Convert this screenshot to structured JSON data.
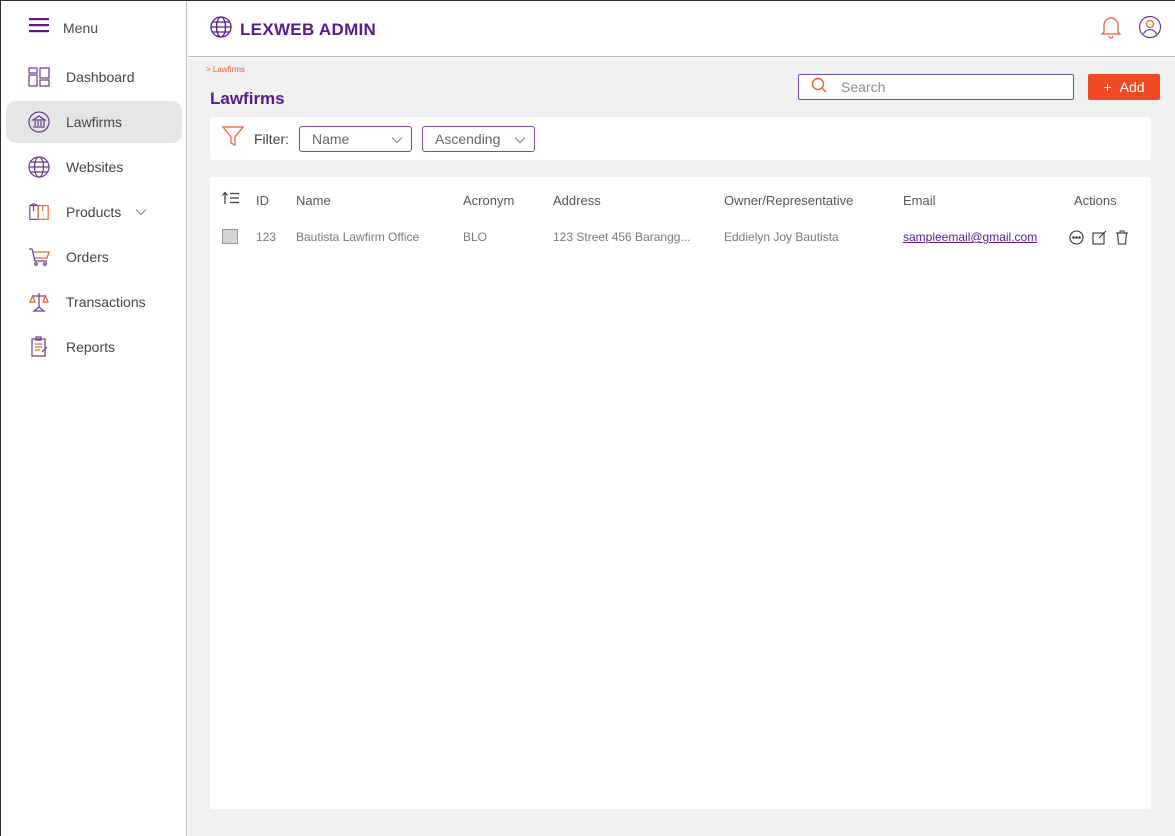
{
  "app": {
    "title": "LEXWEB ADMIN"
  },
  "sidebar": {
    "menu_label": "Menu",
    "items": [
      {
        "label": "Dashboard",
        "icon": "dashboard-icon"
      },
      {
        "label": "Lawfirms",
        "icon": "bank-icon",
        "active": true
      },
      {
        "label": "Websites",
        "icon": "globe-icon"
      },
      {
        "label": "Products",
        "icon": "box-icon",
        "expandable": true
      },
      {
        "label": "Orders",
        "icon": "cart-icon"
      },
      {
        "label": "Transactions",
        "icon": "scales-icon"
      },
      {
        "label": "Reports",
        "icon": "report-icon"
      }
    ]
  },
  "main": {
    "breadcrumb": "> Lawfirms",
    "page_title": "Lawfirms",
    "search_placeholder": "Search",
    "add_label": "Add",
    "filter": {
      "label": "Filter:",
      "field": "Name",
      "order": "Ascending"
    },
    "table": {
      "headers": {
        "id": "ID",
        "name": "Name",
        "acronym": "Acronym",
        "address": "Address",
        "owner": "Owner/Representative",
        "email": "Email",
        "actions": "Actions"
      },
      "rows": [
        {
          "id": "123",
          "name": "Bautista Lawfirm Office",
          "acronym": "BLO",
          "address": "123 Street 456  Barangg...",
          "owner": "Eddielyn Joy Bautista",
          "email": "sampleemail@gmail.com"
        }
      ]
    }
  },
  "colors": {
    "brand_purple": "#5b1a8a",
    "accent_orange": "#f04a23",
    "main_bg": "#f1f1f1"
  }
}
